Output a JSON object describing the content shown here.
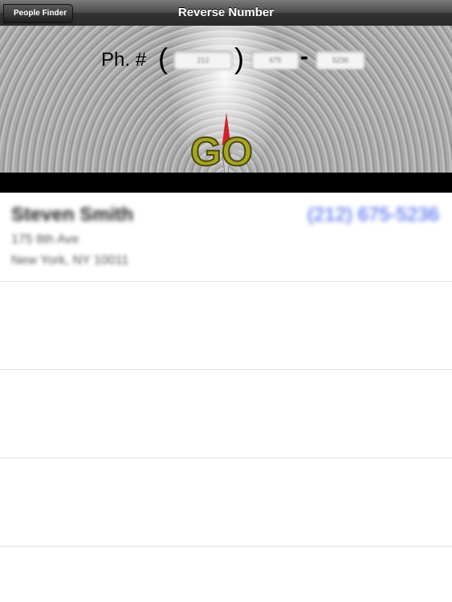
{
  "navbar": {
    "back_label": "People Finder",
    "title": "Reverse Number"
  },
  "phone_form": {
    "label": "Ph. #",
    "open_paren": "(",
    "close_paren": ")",
    "dash": "-",
    "area_code_placeholder": "212",
    "prefix_placeholder": "675",
    "line_placeholder": "5236"
  },
  "logo": {
    "text": "GO",
    "name": "go-compass-logo"
  },
  "results": [
    {
      "name": "Steven Smith",
      "phone": "(212) 675-5236",
      "address_line1": "175 8th Ave",
      "address_line2": "New York, NY 10011"
    },
    {
      "name": "",
      "phone": "",
      "address_line1": "",
      "address_line2": ""
    },
    {
      "name": "",
      "phone": "",
      "address_line1": "",
      "address_line2": ""
    },
    {
      "name": "",
      "phone": "",
      "address_line1": "",
      "address_line2": ""
    }
  ],
  "colors": {
    "link_blue": "#3355ee",
    "navbar_dark": "#2a2a2a",
    "logo_olive": "#a7a522",
    "compass_red": "#d2232a"
  }
}
